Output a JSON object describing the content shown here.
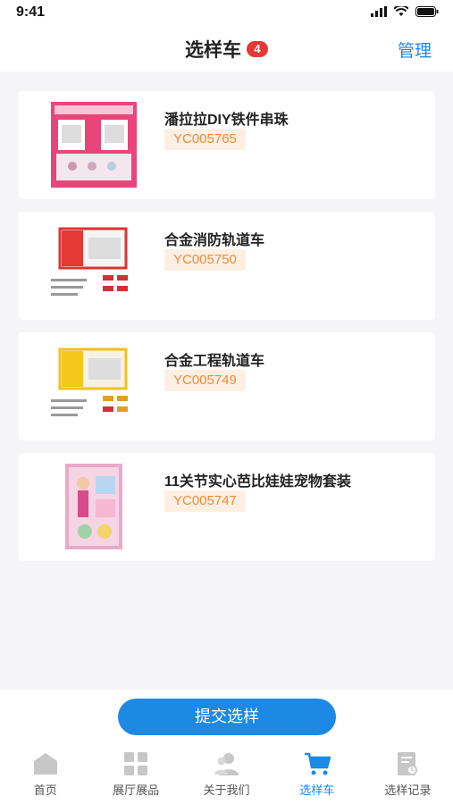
{
  "status": {
    "time": "9:41"
  },
  "header": {
    "title": "选样车",
    "badge": "4",
    "manage_label": "管理"
  },
  "items": [
    {
      "title": "潘拉拉DIY铁件串珠",
      "code": "YC005765"
    },
    {
      "title": "合金消防轨道车",
      "code": "YC005750"
    },
    {
      "title": "合金工程轨道车",
      "code": "YC005749"
    },
    {
      "title": "11关节实心芭比娃娃宠物套装",
      "code": "YC005747"
    }
  ],
  "footer": {
    "submit_label": "提交选样"
  },
  "tabs": [
    {
      "label": "首页",
      "icon": "home-icon",
      "active": false
    },
    {
      "label": "展厅展品",
      "icon": "grid-icon",
      "active": false
    },
    {
      "label": "关于我们",
      "icon": "people-icon",
      "active": false
    },
    {
      "label": "选样车",
      "icon": "cart-icon",
      "active": true
    },
    {
      "label": "选样记录",
      "icon": "record-icon",
      "active": false
    }
  ],
  "colors": {
    "accent": "#1e88e5",
    "badge": "#e53935",
    "code_text": "#f08a3a",
    "code_bg": "#fdf0e2"
  }
}
